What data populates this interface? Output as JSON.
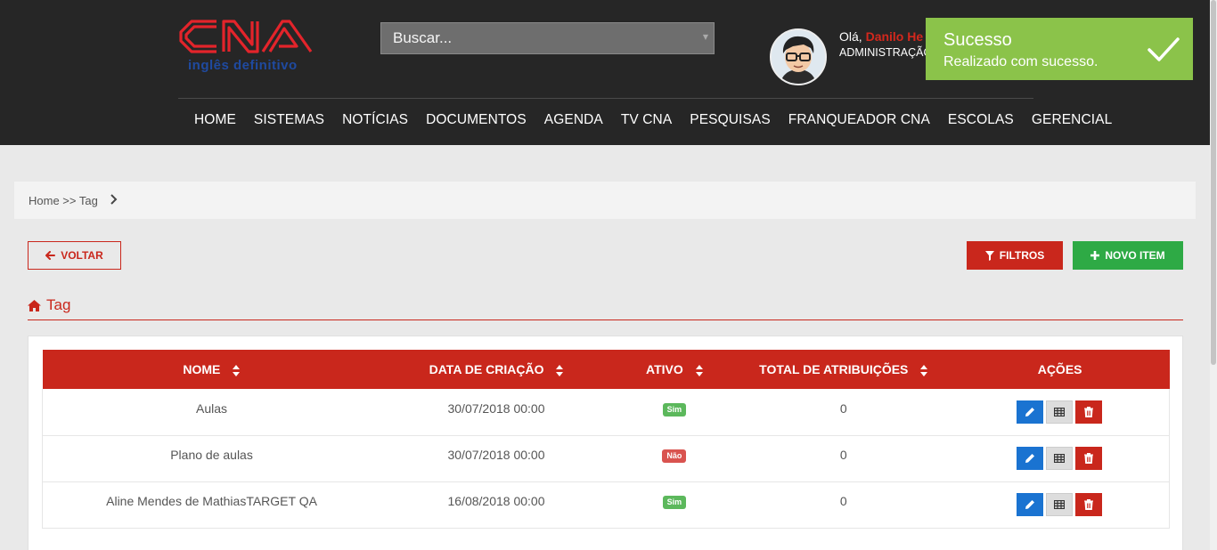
{
  "header": {
    "logo_text": "CNA",
    "logo_tagline": "inglês definitivo",
    "search_placeholder": "Buscar...",
    "greeting_prefix": "Olá,",
    "user_name": "Danilo He",
    "user_role": "ADMINISTRAÇÃO",
    "nav": [
      "HOME",
      "SISTEMAS",
      "NOTÍCIAS",
      "DOCUMENTOS",
      "AGENDA",
      "TV CNA",
      "PESQUISAS",
      "FRANQUEADOR CNA",
      "ESCOLAS",
      "GERENCIAL"
    ]
  },
  "toast": {
    "title": "Sucesso",
    "message": "Realizado com sucesso.",
    "color": "#8bc34a"
  },
  "breadcrumb": {
    "text": "Home >> Tag"
  },
  "toolbar": {
    "back_label": "VOLTAR",
    "filters_label": "FILTROS",
    "new_label": "NOVO ITEM"
  },
  "section": {
    "title": "Tag"
  },
  "table": {
    "columns": [
      "NOME",
      "DATA DE CRIAÇÃO",
      "ATIVO",
      "TOTAL DE ATRIBUIÇÕES",
      "AÇÕES"
    ],
    "rows": [
      {
        "nome": "Aulas",
        "data": "30/07/2018 00:00",
        "ativo": "Sim",
        "total": "0"
      },
      {
        "nome": "Plano de aulas",
        "data": "30/07/2018 00:00",
        "ativo": "Não",
        "total": "0"
      },
      {
        "nome": "Aline Mendes de MathiasTARGET QA",
        "data": "16/08/2018 00:00",
        "ativo": "Sim",
        "total": "0"
      }
    ]
  },
  "colors": {
    "brand_red": "#c9271c",
    "header_bg": "#262626",
    "success_green": "#2eaa45",
    "edit_blue": "#1a73d1"
  }
}
